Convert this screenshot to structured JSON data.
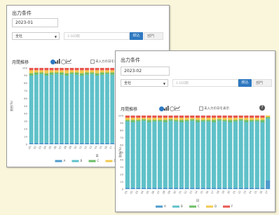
{
  "panels": [
    {
      "title": "出力条件",
      "month": "2023-01",
      "select_label": "全社",
      "search_placeholder": "1:1ED院",
      "search_button": "絞込",
      "dept_button": "部門",
      "trend_label": "月間推移",
      "show_unentered_label": "未入力の日を表示"
    },
    {
      "title": "出力条件",
      "month": "2023-02",
      "select_label": "全社",
      "search_placeholder": "1:1ED院",
      "search_button": "絞込",
      "dept_button": "部門",
      "trend_label": "月間推移",
      "show_unentered_label": "未入力の日を表示"
    }
  ],
  "chart_data": [
    {
      "type": "bar",
      "stacked": true,
      "ylabel": "割合(%)",
      "xlabel": "日",
      "ylim": [
        0,
        100
      ],
      "yticks": [
        0,
        10,
        20,
        30,
        40,
        50,
        60,
        70,
        80,
        90,
        100
      ],
      "categories": [
        "01",
        "02",
        "03",
        "04",
        "05",
        "06",
        "07",
        "08",
        "09",
        "10",
        "11",
        "12",
        "13",
        "14",
        "15",
        "16",
        "17",
        "18",
        "19",
        "20",
        "21",
        "22",
        "23",
        "24",
        "25",
        "26",
        "27"
      ],
      "series": [
        {
          "name": "A",
          "color": "#4e9bcd",
          "values": [
            2,
            2,
            2,
            2,
            2,
            2,
            2,
            2,
            2,
            2,
            2,
            2,
            2,
            2,
            2,
            2,
            2,
            2,
            2,
            2,
            2,
            2,
            2,
            2,
            2,
            2,
            2
          ]
        },
        {
          "name": "B",
          "color": "#5fc1c9",
          "values": [
            88,
            89,
            90,
            88,
            89,
            90,
            89,
            88,
            90,
            89,
            88,
            89,
            90,
            88,
            89,
            90,
            89,
            88,
            89,
            90,
            88,
            89,
            90,
            89,
            88,
            89,
            90
          ]
        },
        {
          "name": "C",
          "color": "#6dbd66",
          "values": [
            3,
            3,
            2,
            3,
            3,
            2,
            3,
            3,
            2,
            3,
            3,
            3,
            2,
            3,
            3,
            2,
            3,
            3,
            3,
            2,
            3,
            3,
            2,
            3,
            3,
            3,
            2
          ]
        },
        {
          "name": "D",
          "color": "#f2c94c",
          "values": [
            4,
            3,
            3,
            4,
            3,
            3,
            3,
            4,
            3,
            3,
            4,
            3,
            3,
            4,
            3,
            3,
            3,
            4,
            3,
            3,
            4,
            3,
            3,
            3,
            4,
            3,
            3
          ]
        },
        {
          "name": "F",
          "color": "#e8574e",
          "values": [
            3,
            3,
            3,
            3,
            3,
            3,
            3,
            3,
            3,
            3,
            3,
            3,
            3,
            3,
            3,
            3,
            3,
            3,
            3,
            3,
            3,
            3,
            3,
            3,
            3,
            3,
            3
          ]
        }
      ]
    },
    {
      "type": "bar",
      "stacked": true,
      "ylabel": "割合(%)",
      "xlabel": "日",
      "ylim": [
        0,
        100
      ],
      "yticks": [
        0,
        10,
        20,
        30,
        40,
        50,
        60,
        70,
        80,
        90,
        100
      ],
      "categories": [
        "01",
        "02",
        "03",
        "04",
        "05",
        "06",
        "07",
        "08",
        "09",
        "10",
        "11",
        "12",
        "13",
        "14",
        "15",
        "16",
        "17",
        "18",
        "19",
        "20",
        "21",
        "22",
        "23",
        "24",
        "25",
        "26",
        "27"
      ],
      "series": [
        {
          "name": "A",
          "color": "#4e9bcd",
          "values": [
            2,
            2,
            2,
            2,
            2,
            2,
            2,
            2,
            2,
            2,
            2,
            2,
            2,
            2,
            2,
            2,
            2,
            2,
            2,
            2,
            2,
            2,
            2,
            2,
            2,
            2,
            12
          ]
        },
        {
          "name": "B",
          "color": "#5fc1c9",
          "values": [
            90,
            89,
            90,
            91,
            89,
            90,
            90,
            89,
            91,
            90,
            89,
            90,
            91,
            89,
            90,
            90,
            89,
            91,
            90,
            89,
            90,
            91,
            89,
            90,
            90,
            89,
            84
          ]
        },
        {
          "name": "C",
          "color": "#6dbd66",
          "values": [
            2,
            3,
            2,
            2,
            3,
            2,
            2,
            3,
            2,
            2,
            3,
            2,
            2,
            3,
            2,
            2,
            3,
            2,
            2,
            3,
            2,
            2,
            3,
            2,
            2,
            3,
            2
          ]
        },
        {
          "name": "D",
          "color": "#f2c94c",
          "values": [
            3,
            3,
            3,
            2,
            3,
            3,
            3,
            3,
            2,
            3,
            3,
            3,
            2,
            3,
            3,
            3,
            3,
            2,
            3,
            3,
            3,
            2,
            3,
            3,
            3,
            3,
            2
          ]
        },
        {
          "name": "F",
          "color": "#e8574e",
          "values": [
            3,
            3,
            3,
            3,
            3,
            3,
            3,
            3,
            3,
            3,
            3,
            3,
            3,
            3,
            3,
            3,
            3,
            3,
            3,
            3,
            3,
            3,
            3,
            3,
            3,
            3,
            0
          ]
        }
      ]
    }
  ]
}
